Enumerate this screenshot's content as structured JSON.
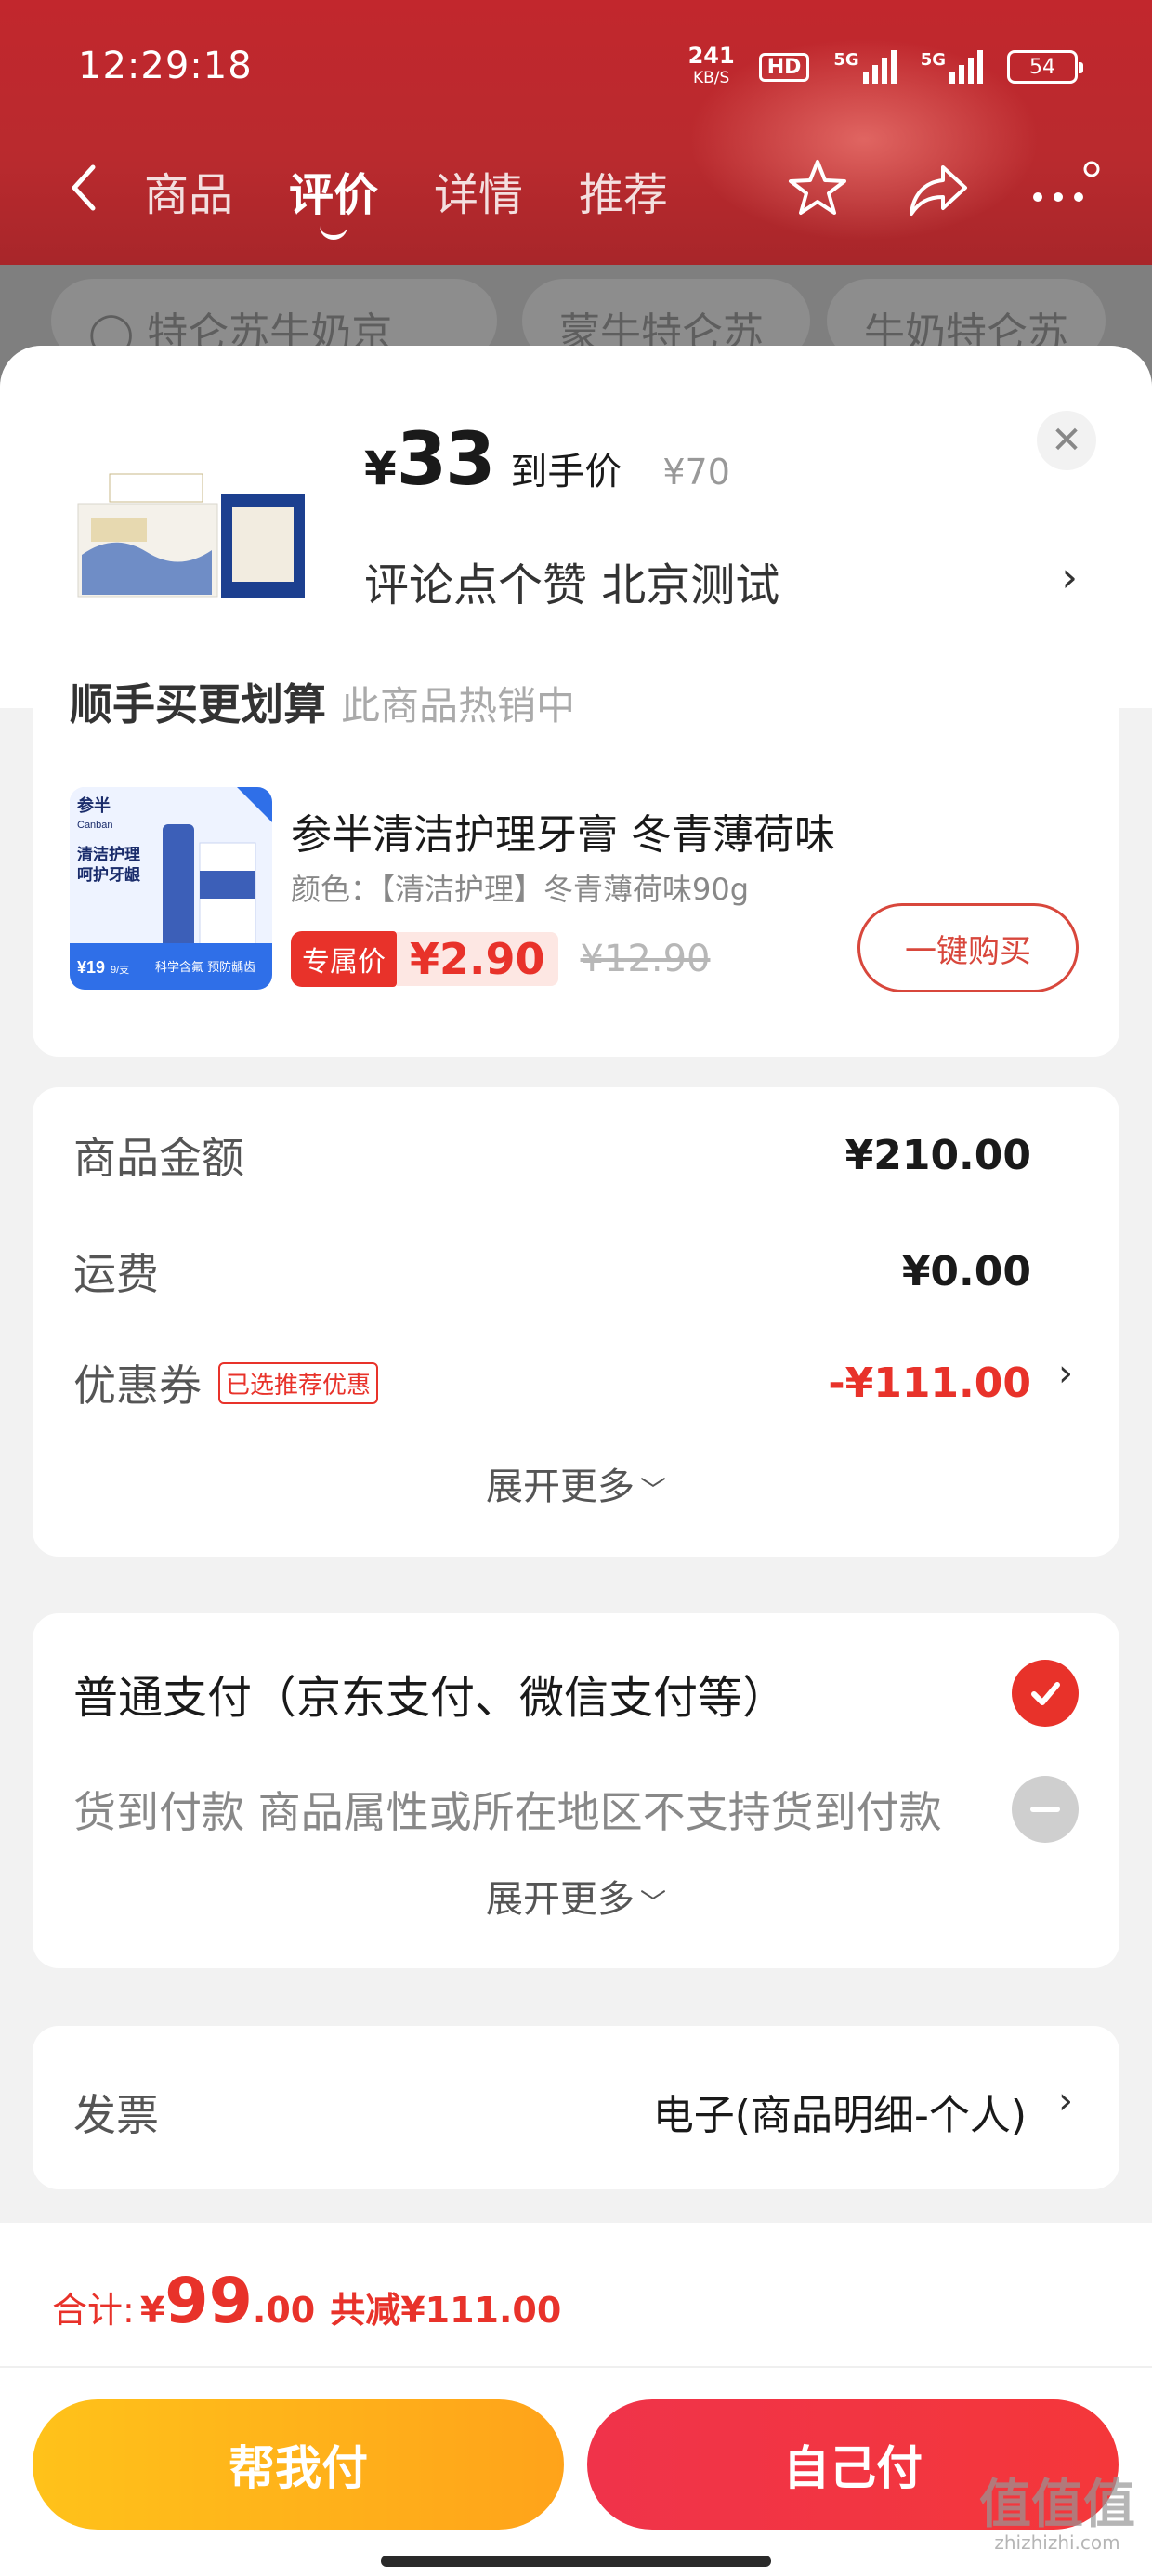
{
  "status_bar": {
    "time": "12:29:18",
    "net_speed": "241",
    "net_unit": "KB/S",
    "hd_label": "HD",
    "signal1_label": "5G",
    "signal2_label": "5G",
    "battery": "54"
  },
  "nav": {
    "tabs": [
      {
        "label": "商品"
      },
      {
        "label": "评价"
      },
      {
        "label": "详情"
      },
      {
        "label": "推荐"
      }
    ],
    "active_tab": "评价"
  },
  "background_search": {
    "chips": [
      "特仑苏牛奶京",
      "蒙牛特仑苏",
      "牛奶特仑苏"
    ]
  },
  "sheet_header": {
    "price_symbol": "¥",
    "price": "33",
    "price_label": "到手价",
    "original_price": "¥70",
    "subtitle": "评论点个赞  北京测试",
    "close_icon": "close-icon",
    "arrow": "›"
  },
  "tie_in": {
    "section_title": "顺手买更划算",
    "section_hint": "此商品热销中",
    "product_name": "参半清洁护理牙膏 冬青薄荷味",
    "spec": "颜色：【清洁护理】冬青薄荷味90g",
    "exclusive_label": "专属价",
    "exclusive_price": "¥2.90",
    "original_price": "¥12.90",
    "buy_button": "一键购买",
    "image_text": {
      "brand": "参半",
      "brand_en": "Canban",
      "headline1": "清洁护理",
      "headline2": "呵护牙龈",
      "price_tag": "¥19",
      "price_unit": "9/支",
      "slogan": "科学含氟 预防龋齿"
    }
  },
  "summary": {
    "rows": [
      {
        "label": "商品金额",
        "value": "¥210.00"
      },
      {
        "label": "运费",
        "value": "¥0.00"
      },
      {
        "label": "优惠券",
        "tag": "已选推荐优惠",
        "value": "-¥111.00"
      }
    ],
    "expand_label": "展开更多",
    "expand_chevron": "﹀"
  },
  "payment": {
    "options": [
      {
        "label": "普通支付（京东支付、微信支付等）",
        "selected": true
      },
      {
        "label": "货到付款 商品属性或所在地区不支持货到付款",
        "selected": false
      }
    ],
    "expand_label": "展开更多",
    "expand_chevron": "﹀"
  },
  "invoice": {
    "label": "发票",
    "value": "电子(商品明细-个人)",
    "arrow": "›"
  },
  "footer": {
    "total_label": "合计:",
    "total_symbol": "¥",
    "total_int": "99",
    "total_dec": ".00",
    "total_save": "共减¥111.00",
    "help_pay_button": "帮我付",
    "self_pay_button": "自己付"
  },
  "watermark": {
    "glyphs": "值值值",
    "site": "zhizhizhi.com"
  },
  "colors": {
    "accent_red": "#e8322a",
    "header_red": "#c2272d",
    "help_pay_yellow": "#ffb21a",
    "self_pay_red": "#f2353f"
  }
}
